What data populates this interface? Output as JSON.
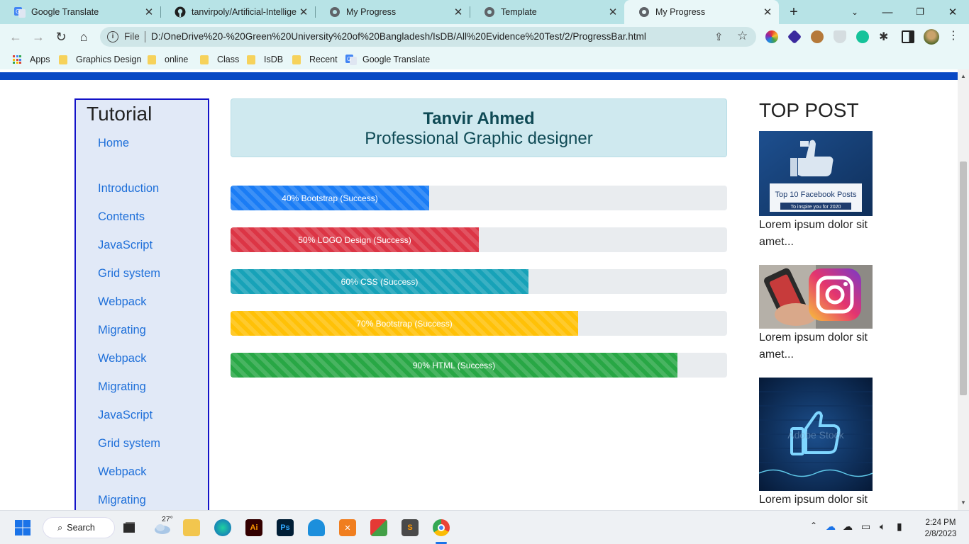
{
  "browser": {
    "tabs": [
      {
        "title": "Google Translate",
        "icon": "google-translate-icon",
        "active": false
      },
      {
        "title": "tanvirpoly/Artificial-Intelligen",
        "icon": "github-icon",
        "active": false
      },
      {
        "title": "My Progress",
        "icon": "globe-icon",
        "active": false
      },
      {
        "title": "Template",
        "icon": "globe-icon",
        "active": false
      },
      {
        "title": "My Progress",
        "icon": "globe-icon",
        "active": true
      }
    ],
    "address": {
      "scheme_label": "File",
      "url": "D:/OneDrive%20-%20Green%20University%20of%20Bangladesh/IsDB/All%20Evidence%20Test/2/ProgressBar.html"
    },
    "bookmarks": [
      {
        "label": "Apps",
        "icon": "apps-grid-icon"
      },
      {
        "label": "Graphics Design",
        "icon": "folder-icon"
      },
      {
        "label": "online",
        "icon": "folder-icon"
      },
      {
        "label": "Class",
        "icon": "folder-icon"
      },
      {
        "label": "IsDB",
        "icon": "folder-icon"
      },
      {
        "label": "Recent",
        "icon": "folder-icon"
      },
      {
        "label": "Google Translate",
        "icon": "google-translate-icon"
      }
    ]
  },
  "page": {
    "sidebar": {
      "title": "Tutorial",
      "links": [
        "Home",
        "Introduction",
        "Contents",
        "JavaScript",
        "Grid system",
        "Webpack",
        "Migrating",
        "Webpack",
        "Migrating",
        "JavaScript",
        "Grid system",
        "Webpack",
        "Migrating"
      ]
    },
    "header": {
      "name": "Tanvir Ahmed",
      "role": "Professional Graphic designer"
    },
    "progress_bars": [
      {
        "label": "40% Bootstrap (Success)",
        "percent": 40,
        "color": "#1a7cf5"
      },
      {
        "label": "50% LOGO Design (Success)",
        "percent": 50,
        "color": "#dc3545"
      },
      {
        "label": "60% CSS (Success)",
        "percent": 60,
        "color": "#17a2b8"
      },
      {
        "label": "70% Bootstrap (Success)",
        "percent": 70,
        "color": "#ffc107"
      },
      {
        "label": "90% HTML (Success)",
        "percent": 90,
        "color": "#28a745"
      }
    ],
    "top_post": {
      "title": "TOP POST",
      "posts": [
        {
          "image": "facebook-thumbs-up-image",
          "image_caption": "Top 10 Facebook Posts",
          "image_subcaption": "To inspire you for 2020",
          "text": "Lorem ipsum dolor sit amet..."
        },
        {
          "image": "instagram-phone-image",
          "text": "Lorem ipsum dolor sit amet..."
        },
        {
          "image": "neon-like-image",
          "image_caption": "Adobe Stock",
          "text": "Lorem ipsum dolor sit"
        }
      ]
    }
  },
  "taskbar": {
    "weather": "27°",
    "search_label": "Search",
    "time": "2:24 PM",
    "date": "2/8/2023"
  }
}
